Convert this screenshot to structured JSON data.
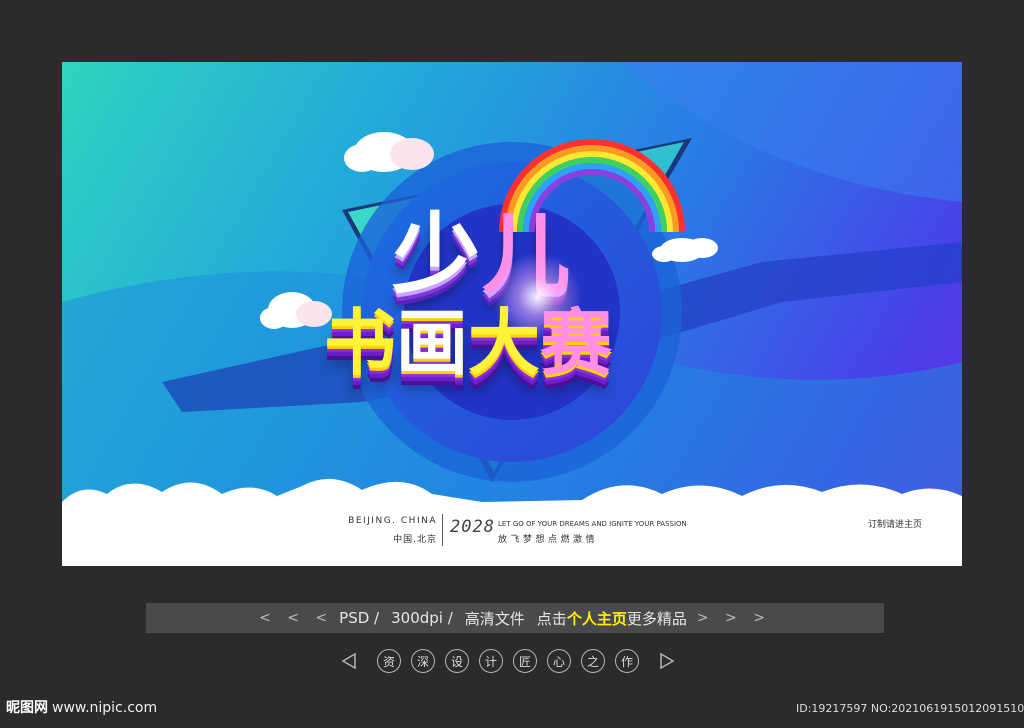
{
  "poster": {
    "title_line1": [
      "少",
      "儿"
    ],
    "title_line2": [
      "书",
      "画",
      "大",
      "赛"
    ],
    "footer": {
      "city": "BEIJING. CHINA",
      "city_cn": "中国.北京",
      "year": "2028",
      "slogan_en": "LET GO OF YOUR DREAMS AND IGNITE YOUR PASSION",
      "slogan_cn": "放飞梦想点燃激情",
      "right_text": "订制请进主页"
    }
  },
  "info_bar": {
    "left_arrows": "< < <",
    "format": "PSD /",
    "dpi": "300dpi /",
    "quality": "高清文件",
    "click_text": "点击",
    "highlight": "个人主页",
    "more_text": "更多精品",
    "right_arrows": "> > >"
  },
  "tagline_chars": [
    "资",
    "深",
    "设",
    "计",
    "匠",
    "心",
    "之",
    "作"
  ],
  "site": {
    "logo": "昵图网",
    "url": "www.nipic.com"
  },
  "image_id": "ID:19217597 NO:20210619150120915105",
  "colors": {
    "highlight": "#fff200",
    "page_bg": "#2b2b2d",
    "bar_bg": "#4a4a4c"
  }
}
